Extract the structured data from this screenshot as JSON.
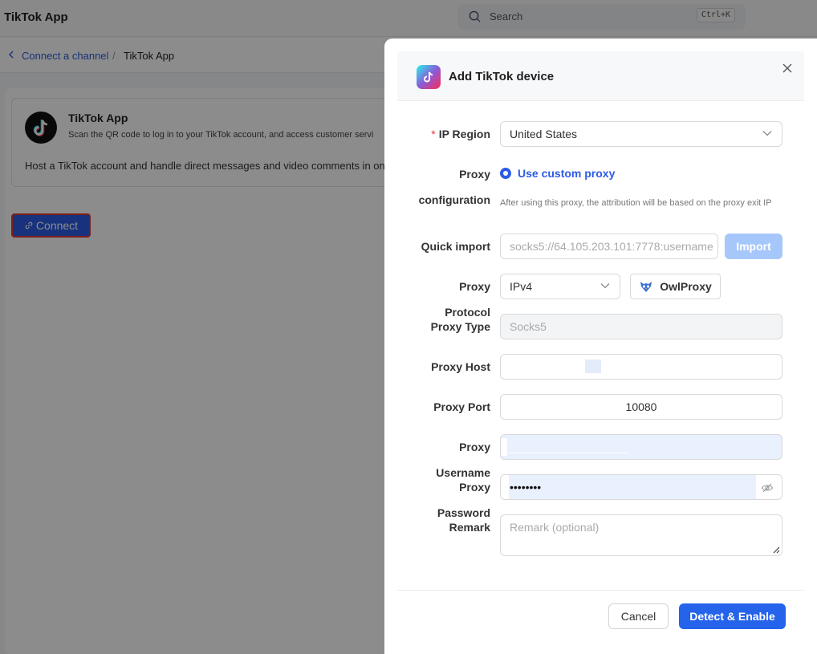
{
  "app": {
    "title": "TikTok App"
  },
  "search": {
    "placeholder": "Search",
    "shortcut": "Ctrl+K"
  },
  "breadcrumb": {
    "parent": "Connect a channel",
    "separator": "/",
    "current": "TikTok App"
  },
  "channel_card": {
    "title": "TikTok App",
    "subtitle": "Scan the QR code to log in to your TikTok account, and access customer servi",
    "description": "Host a TikTok account and handle direct messages and video comments in one p"
  },
  "connect_button": {
    "label": "Connect"
  },
  "drawer": {
    "title": "Add TikTok device",
    "ip_region": {
      "label": "IP Region",
      "value": "United States"
    },
    "proxy_configuration": {
      "label_line1": "Proxy",
      "label_line2": "configuration",
      "option_label": "Use custom proxy",
      "hint": "After using this proxy, the attribution will be based on the proxy exit IP"
    },
    "quick_import": {
      "label": "Quick import",
      "placeholder": "socks5://64.105.203.101:7778:username",
      "button": "Import"
    },
    "proxy_protocol": {
      "label_line1": "Proxy",
      "label_line2": "Protocol",
      "value": "IPv4",
      "owlproxy_button": "OwlProxy"
    },
    "proxy_type": {
      "label": "Proxy Type",
      "value": "Socks5"
    },
    "proxy_host": {
      "label": "Proxy Host",
      "value": ""
    },
    "proxy_port": {
      "label": "Proxy Port",
      "value": "10080"
    },
    "proxy_username": {
      "label_line1": "Proxy",
      "label_line2": "Username",
      "value": ""
    },
    "proxy_password": {
      "label_line1": "Proxy",
      "label_line2": "Password",
      "value": "••••••••"
    },
    "remark": {
      "label": "Remark",
      "placeholder": "Remark (optional)"
    },
    "cancel_button": "Cancel",
    "submit_button": "Detect & Enable"
  },
  "colors": {
    "primary": "#2563eb",
    "import_disabled": "#a6c7fb",
    "required": "#e53935",
    "autofill": "#e9f0fe"
  },
  "icons": [
    "search-icon",
    "chevron-left-icon",
    "tiktok-logo-icon",
    "link-icon",
    "close-icon",
    "chevron-down-icon",
    "owl-icon",
    "eye-off-icon",
    "resize-handle-icon"
  ]
}
